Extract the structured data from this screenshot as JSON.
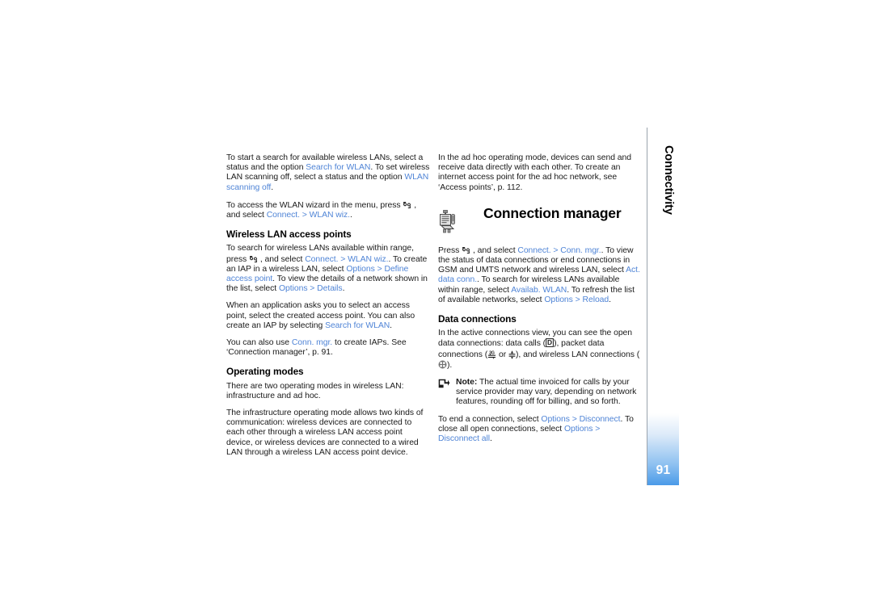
{
  "document": {
    "page_number": "91",
    "side_tab_label": "Connectivity",
    "link_color": "#4f84d6",
    "text_color": "#1a1a1a"
  },
  "left_column": {
    "para_wlan_search": {
      "t1": "To start a search for available wireless LANs, select a status and the option ",
      "l1": "Search for WLAN",
      "t2": ". To set wireless LAN scanning off, select a status and the option ",
      "l2": "WLAN scanning off",
      "t3": "."
    },
    "para_wizard": {
      "t1": "To access the WLAN wizard in the menu, press ",
      "icon": "menu-key-icon",
      "t2": " , and select ",
      "l1": "Connect.",
      "sep": " > ",
      "l2": "WLAN wiz.",
      "t3": "."
    },
    "heading_access_points": "Wireless LAN access points",
    "para_search_range": {
      "t1": "To search for wireless LANs available within range, press ",
      "icon": "menu-key-icon",
      "t2": " , and select ",
      "l1": "Connect.",
      "sep1": " > ",
      "l2": "WLAN wiz.",
      "t3": ". To create an IAP in a wireless LAN, select ",
      "l3": "Options",
      "sep2": " > ",
      "l4": "Define access point",
      "t4": ". To view the details of a network shown in the list, select ",
      "l5": "Options",
      "sep3": " > ",
      "l6": "Details",
      "t5": "."
    },
    "para_application_asks": {
      "t1": "When an application asks you to select an access point, select the created access point. You can also create an IAP by selecting ",
      "l1": "Search for WLAN",
      "t2": "."
    },
    "para_conn_mgr": {
      "t1": "You can also use ",
      "l1": "Conn. mgr.",
      "t2": " to create IAPs. See ‘Connection manager’, p. 91."
    },
    "heading_operating_modes": "Operating modes",
    "para_two_modes": "There are two operating modes in wireless LAN: infrastructure and ad hoc.",
    "para_infrastructure": "The infrastructure operating mode allows two kinds of communication: wireless devices are connected to each other through a wireless LAN access point device, or wireless devices are connected to a wired LAN through a wireless LAN access point device."
  },
  "right_column": {
    "para_ad_hoc": "In the ad hoc operating mode, devices can send and receive data directly with each other. To create an internet access point for the ad hoc network, see ‘Access points’, p. 112.",
    "heading_connection_manager": "Connection manager",
    "connection_manager_icon": "connection-manager-icon",
    "para_press_connect": {
      "t1": "Press ",
      "icon": "menu-key-icon",
      "t2": " , and select ",
      "l1": "Connect.",
      "sep1": " > ",
      "l2": "Conn. mgr.",
      "t3": ". To view the status of data connections or end connections in GSM and UMTS network and wireless LAN, select ",
      "l3": "Act. data conn.",
      "t4": ". To search for wireless LANs available within range, select ",
      "l4": "Availab. WLAN",
      "t5": ". To refresh the list of available networks, select ",
      "l5": "Options",
      "sep2": " > ",
      "l6": "Reload",
      "t6": "."
    },
    "heading_data_connections": "Data connections",
    "para_active_view": {
      "t1": "In the active connections view, you can see the open data connections: data calls (",
      "icon1": "data-call-d-icon",
      "t2": "), packet data connections (",
      "icon2": "packet-3g-icon",
      "t3": " or ",
      "icon3": "packet-gprs-icon",
      "t4": "), and wireless LAN connections (",
      "icon4": "wlan-grid-icon",
      "t5": ")."
    },
    "note": {
      "icon": "note-arrow-icon",
      "label": "Note:",
      "text": " The actual time invoiced for calls by your service provider may vary, depending on network features, rounding off for billing, and so forth."
    },
    "para_end_connection": {
      "t1": "To end a connection, select ",
      "l1": "Options",
      "sep1": " > ",
      "l2": "Disconnect",
      "t2": ". To close all open connections, select ",
      "l3": "Options",
      "sep2": " > ",
      "l4": "Disconnect all",
      "t3": "."
    }
  }
}
